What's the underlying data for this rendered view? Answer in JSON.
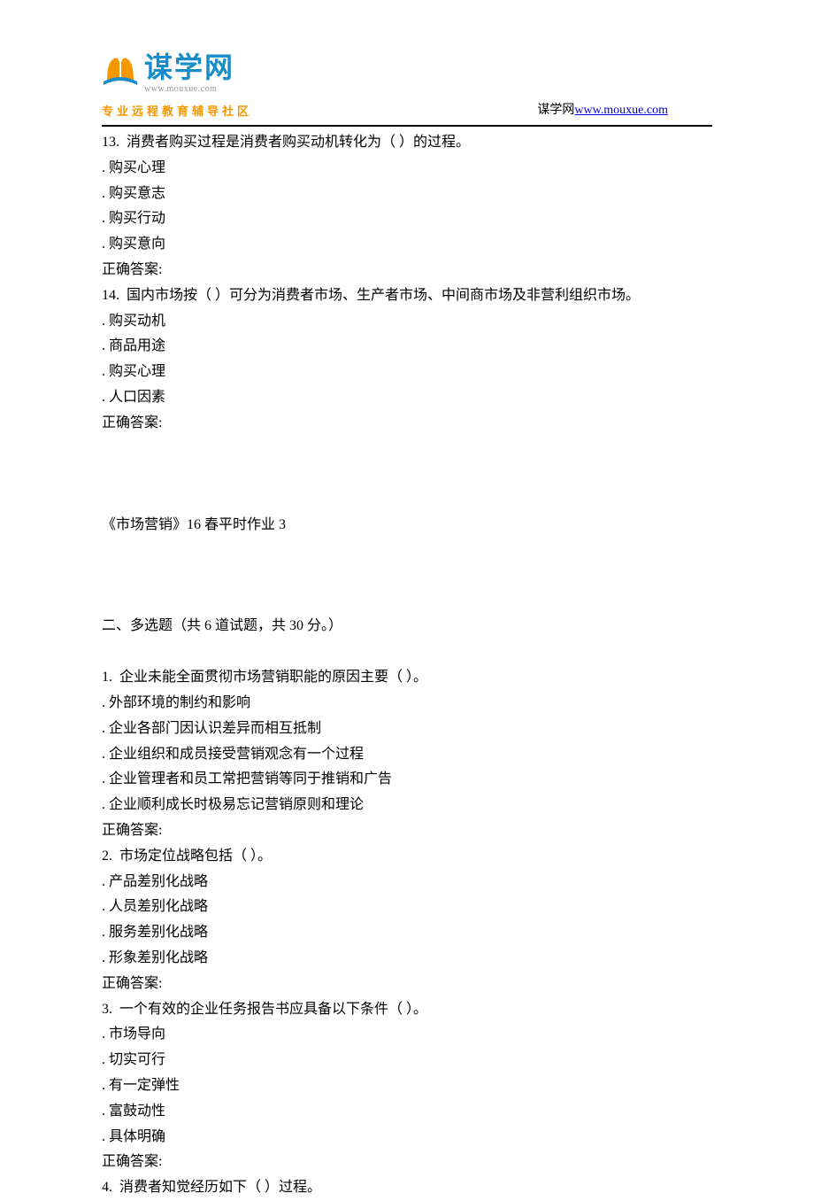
{
  "header": {
    "logo_title": "谋学网",
    "logo_url": "www.mouxue.com",
    "logo_subtitle": "专业远程教育辅导社区",
    "site_label": "谋学网",
    "site_link": "www.mouxue.com"
  },
  "q13": {
    "text": "13.  消费者购买过程是消费者购买动机转化为（ ）的过程。",
    "opts": [
      ". 购买心理",
      ". 购买意志",
      ". 购买行动",
      ". 购买意向"
    ],
    "answer": "正确答案:"
  },
  "q14": {
    "text": "14.  国内市场按（ ）可分为消费者市场、生产者市场、中间商市场及非营利组织市场。",
    "opts": [
      ". 购买动机",
      ". 商品用途",
      ". 购买心理",
      ". 人口因素"
    ],
    "answer": "正确答案:"
  },
  "section_title": "《市场营销》16 春平时作业 3",
  "part2_title": "二、多选题（共 6 道试题，共 30 分。）",
  "mq1": {
    "text": "1.  企业未能全面贯彻市场营销职能的原因主要（ ）。",
    "opts": [
      ". 外部环境的制约和影响",
      ". 企业各部门因认识差异而相互抵制",
      ". 企业组织和成员接受营销观念有一个过程",
      ". 企业管理者和员工常把营销等同于推销和广告",
      ". 企业顺利成长时极易忘记营销原则和理论"
    ],
    "answer": "正确答案:"
  },
  "mq2": {
    "text": "2.  市场定位战略包括（ ）。",
    "opts": [
      ". 产品差别化战略",
      ". 人员差别化战略",
      ". 服务差别化战略",
      ". 形象差别化战略"
    ],
    "answer": "正确答案:"
  },
  "mq3": {
    "text": "3.  一个有效的企业任务报告书应具备以下条件（ ）。",
    "opts": [
      ". 市场导向",
      ". 切实可行",
      ". 有一定弹性",
      ". 富鼓动性",
      ". 具体明确"
    ],
    "answer": "正确答案:"
  },
  "mq4": {
    "text": "4.  消费者知觉经历如下（ ）过程。"
  }
}
